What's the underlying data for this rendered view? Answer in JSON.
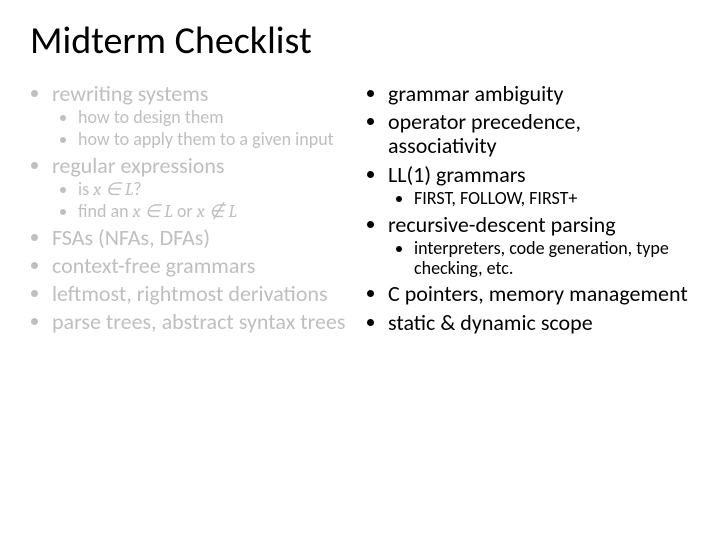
{
  "title": "Midterm Checklist",
  "left": {
    "i0": "rewriting systems",
    "i0a": "how to design them",
    "i0b": "how to apply them to a given input",
    "i1": "regular expressions",
    "i1a_pre": "is ",
    "i1a_math": "x ∈ L",
    "i1a_post": "?",
    "i1b_pre": "find an ",
    "i1b_math1": "x ∈ L",
    "i1b_mid": " or ",
    "i1b_math2": "x ∉ L",
    "i2": "FSAs (NFAs, DFAs)",
    "i3": "context-free grammars",
    "i4": "leftmost, rightmost derivations",
    "i5": "parse trees, abstract syntax trees"
  },
  "right": {
    "r0": "grammar ambiguity",
    "r1": "operator precedence, associativity",
    "r2": "LL(1) grammars",
    "r2a": "FIRST, FOLLOW, FIRST+",
    "r3": "recursive-descent parsing",
    "r3a": "interpreters, code generation, type checking, etc.",
    "r4": "C pointers, memory management",
    "r5": "static & dynamic scope"
  }
}
